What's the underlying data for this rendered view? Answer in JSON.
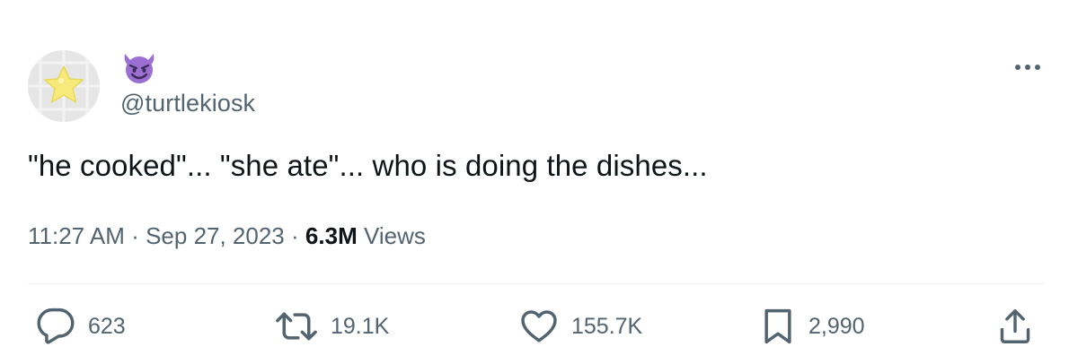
{
  "tweet": {
    "handle": "@turtlekiosk",
    "display_name_emoji": "😈",
    "text": "\"he cooked\"... \"she ate\"... who is doing the dishes...",
    "time": "11:27 AM",
    "separator": "·",
    "date": "Sep 27, 2023",
    "views_count": "6.3M",
    "views_label": "Views"
  },
  "actions": {
    "replies": "623",
    "reposts": "19.1K",
    "likes": "155.7K",
    "bookmarks": "2,990"
  },
  "icons": {
    "avatar": "star-icon",
    "name": "smiling-devil-icon",
    "more": "more-icon",
    "reply": "reply-icon",
    "repost": "repost-icon",
    "like": "like-icon",
    "bookmark": "bookmark-icon",
    "share": "share-icon"
  },
  "colors": {
    "text": "#0f1419",
    "secondary": "#536471",
    "divider": "#eff3f4",
    "emoji": "#9b6fd1"
  }
}
